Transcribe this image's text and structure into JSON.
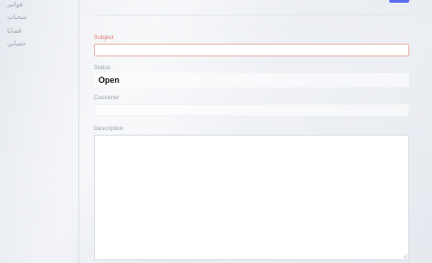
{
  "sidebar": {
    "items": [
      {
        "label": "فواتير"
      },
      {
        "label": "شحنات"
      },
      {
        "label": "قضايا"
      },
      {
        "label": "حسابي"
      }
    ]
  },
  "form": {
    "subject": {
      "label": "Subject",
      "value": "",
      "required": true
    },
    "status": {
      "label": "Status",
      "value": "Open"
    },
    "customer": {
      "label": "Customer",
      "value": ""
    },
    "description": {
      "label": "Description",
      "value": ""
    }
  },
  "colors": {
    "accent": "#5c6cf0",
    "required_label": "#e07a6a",
    "label": "#9aa1ab"
  }
}
